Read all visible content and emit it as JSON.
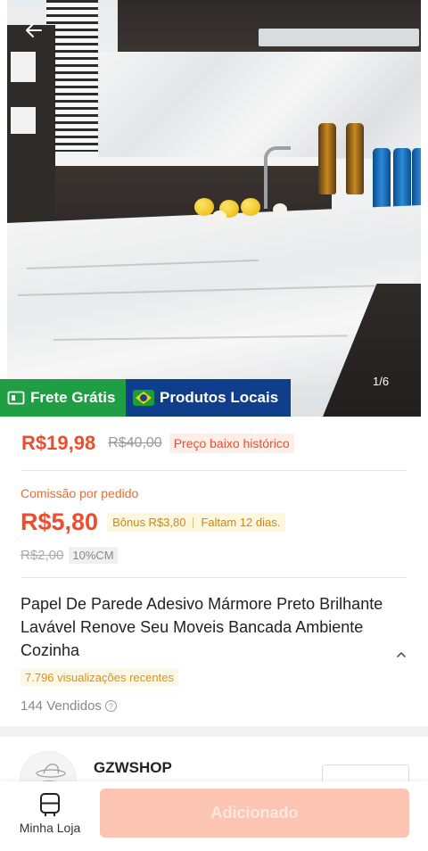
{
  "gallery": {
    "counter": "1/6",
    "badges": {
      "shipping": "Frete Grátis",
      "local": "Produtos Locais"
    }
  },
  "price": {
    "current": "R$19,98",
    "original": "R$40,00",
    "tag": "Preço baixo histórico"
  },
  "commission": {
    "label": "Comissão por pedido",
    "value": "R$5,80",
    "bonus": "Bônus R$3,80",
    "deadline": "Faltam 12 dias.",
    "original": "R$2,00",
    "rate": "10%CM"
  },
  "product": {
    "title": "Papel De Parede Adesivo Mármore Preto Brilhante Lavável Renove Seu Moveis Bancada Ambiente Cozinha",
    "views": "7.796 visualizações recentes",
    "sold": "144 Vendidos"
  },
  "shop": {
    "name": "GZWSHOP"
  },
  "bottom_bar": {
    "my_store": "Minha Loja",
    "add_button": "Adicionado"
  },
  "colors": {
    "accent": "#ee4d2d",
    "shipping_badge": "#1f9e43",
    "local_badge": "#0f3f8a",
    "bonus_text": "#c98a0c",
    "add_button_disabled": "#fcc4b3"
  },
  "icons": {
    "back": "arrow-left-icon",
    "shipping": "truck-icon",
    "local": "brazil-flag-icon",
    "help": "question-circle-icon",
    "collapse": "chevron-up-icon",
    "store": "store-icon"
  }
}
